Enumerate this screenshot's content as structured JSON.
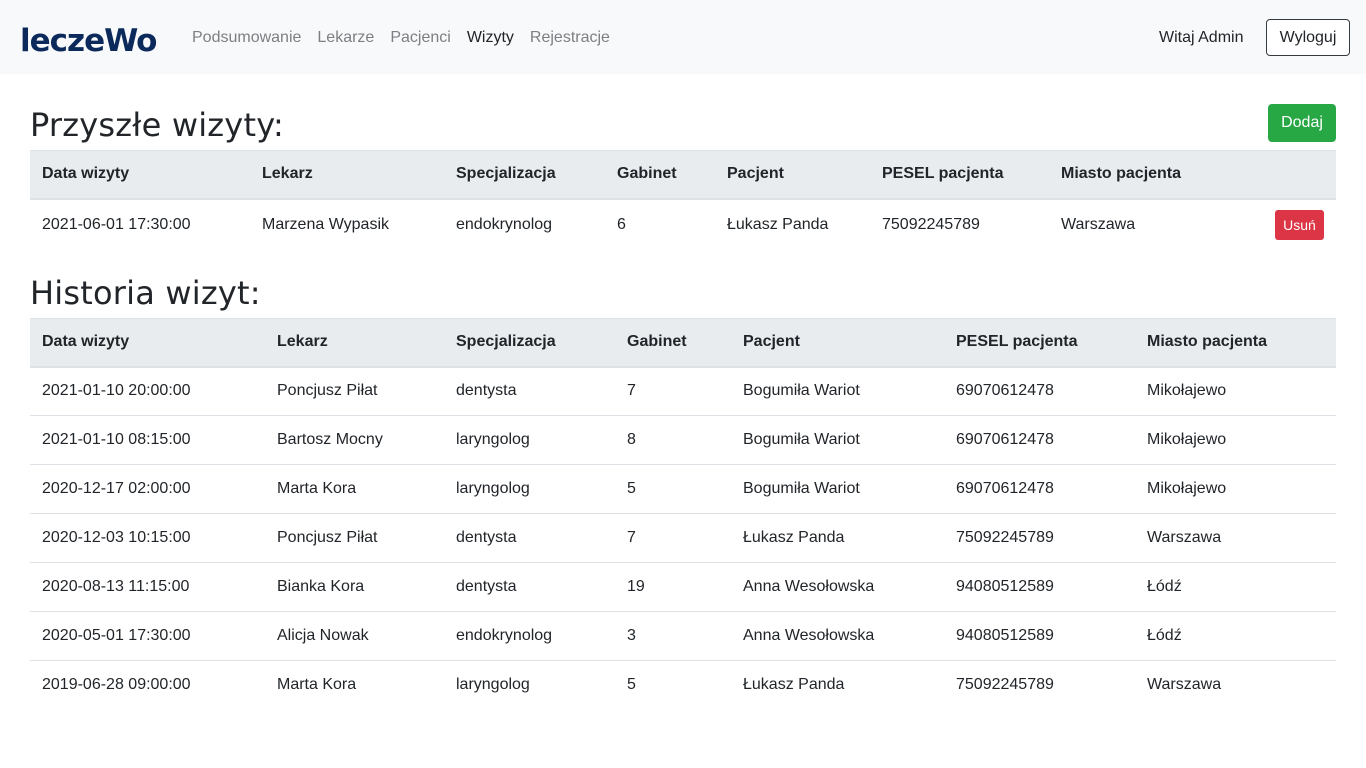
{
  "brand": {
    "name": "leczeWo"
  },
  "nav": {
    "links": [
      {
        "label": "Podsumowanie",
        "active": false
      },
      {
        "label": "Lekarze",
        "active": false
      },
      {
        "label": "Pacjenci",
        "active": false
      },
      {
        "label": "Wizyty",
        "active": true
      },
      {
        "label": "Rejestracje",
        "active": false
      }
    ],
    "greeting": "Witaj Admin",
    "logout_label": "Wyloguj"
  },
  "future": {
    "title": "Przyszłe wizyty:",
    "add_label": "Dodaj",
    "delete_label": "Usuń",
    "columns": [
      "Data wizyty",
      "Lekarz",
      "Specjalizacja",
      "Gabinet",
      "Pacjent",
      "PESEL pacjenta",
      "Miasto pacjenta"
    ],
    "rows": [
      [
        "2021-06-01 17:30:00",
        "Marzena Wypasik",
        "endokrynolog",
        "6",
        "Łukasz Panda",
        "75092245789",
        "Warszawa"
      ]
    ]
  },
  "history": {
    "title": "Historia wizyt:",
    "columns": [
      "Data wizyty",
      "Lekarz",
      "Specjalizacja",
      "Gabinet",
      "Pacjent",
      "PESEL pacjenta",
      "Miasto pacjenta"
    ],
    "rows": [
      [
        "2021-01-10 20:00:00",
        "Poncjusz Piłat",
        "dentysta",
        "7",
        "Bogumiła Wariot",
        "69070612478",
        "Mikołajewo"
      ],
      [
        "2021-01-10 08:15:00",
        "Bartosz Mocny",
        "laryngolog",
        "8",
        "Bogumiła Wariot",
        "69070612478",
        "Mikołajewo"
      ],
      [
        "2020-12-17 02:00:00",
        "Marta Kora",
        "laryngolog",
        "5",
        "Bogumiła Wariot",
        "69070612478",
        "Mikołajewo"
      ],
      [
        "2020-12-03 10:15:00",
        "Poncjusz Piłat",
        "dentysta",
        "7",
        "Łukasz Panda",
        "75092245789",
        "Warszawa"
      ],
      [
        "2020-08-13 11:15:00",
        "Bianka Kora",
        "dentysta",
        "19",
        "Anna Wesołowska",
        "94080512589",
        "Łódź"
      ],
      [
        "2020-05-01 17:30:00",
        "Alicja Nowak",
        "endokrynolog",
        "3",
        "Anna Wesołowska",
        "94080512589",
        "Łódź"
      ],
      [
        "2019-06-28 09:00:00",
        "Marta Kora",
        "laryngolog",
        "5",
        "Łukasz Panda",
        "75092245789",
        "Warszawa"
      ]
    ]
  }
}
